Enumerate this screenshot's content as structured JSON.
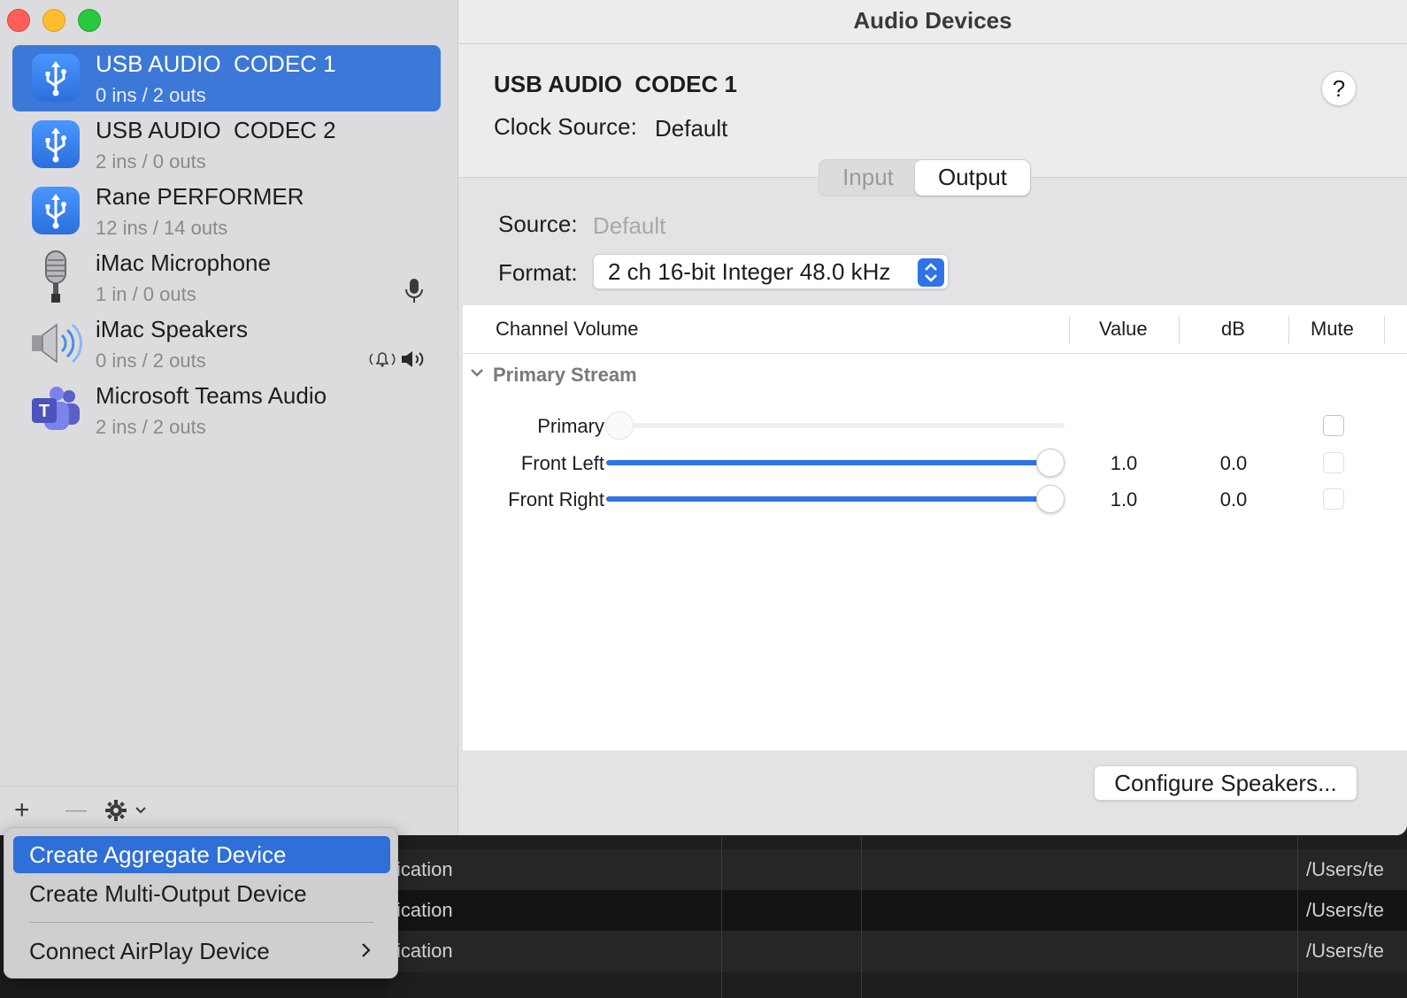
{
  "window": {
    "title": "Audio Devices"
  },
  "devices": [
    {
      "name": "USB AUDIO  CODEC 1",
      "io": "0 ins / 2 outs",
      "icon": "usb-icon",
      "selected": true
    },
    {
      "name": "USB AUDIO  CODEC 2",
      "io": "2 ins / 0 outs",
      "icon": "usb-icon"
    },
    {
      "name": "Rane PERFORMER",
      "io": "12 ins / 14 outs",
      "icon": "usb-icon"
    },
    {
      "name": "iMac Microphone",
      "io": "1 in / 0 outs",
      "icon": "microphone-icon",
      "badge": "default-input-microphone-icon"
    },
    {
      "name": "iMac Speakers",
      "io": "0 ins / 2 outs",
      "icon": "speaker-icon",
      "badge": "default-output-speaker-icon"
    },
    {
      "name": "Microsoft Teams Audio",
      "io": "2 ins / 2 outs",
      "icon": "teams-icon"
    }
  ],
  "footer": {
    "add": "+",
    "remove": "—",
    "gear": "gear-icon"
  },
  "detail": {
    "device_name": "USB AUDIO  CODEC 1",
    "clock_source_label": "Clock Source:",
    "clock_source_value": "Default",
    "help": "?",
    "tabs": [
      {
        "label": "Input",
        "active": false
      },
      {
        "label": "Output",
        "active": true
      }
    ],
    "source_label": "Source:",
    "source_value": "Default",
    "format_label": "Format:",
    "format_value": "2 ch 16-bit Integer 48.0 kHz"
  },
  "table": {
    "headers": [
      "Channel Volume",
      "Value",
      "dB",
      "Mute"
    ],
    "stream": "Primary Stream",
    "channels": [
      {
        "name": "Primary",
        "level": 0.0,
        "value": "",
        "db": "",
        "mute": false,
        "enabled": false
      },
      {
        "name": "Front Left",
        "level": 1.0,
        "value": "1.0",
        "db": "0.0",
        "mute": false,
        "enabled": true
      },
      {
        "name": "Front Right",
        "level": 1.0,
        "value": "1.0",
        "db": "0.0",
        "mute": false,
        "enabled": true
      }
    ]
  },
  "configure_button": "Configure Speakers...",
  "menu": {
    "items": [
      {
        "label": "Create Aggregate Device",
        "active": true
      },
      {
        "label": "Create Multi-Output Device"
      },
      {
        "label": "Connect AirPlay Device",
        "submenu": true
      }
    ]
  },
  "background_rows": [
    {
      "left": "ication",
      "right": "/Users/te"
    },
    {
      "left": "ication",
      "right": "/Users/te"
    },
    {
      "left": "ication",
      "right": "/Users/te"
    }
  ],
  "colors": {
    "accent": "#2f74e6",
    "selection": "#3c78d8"
  }
}
